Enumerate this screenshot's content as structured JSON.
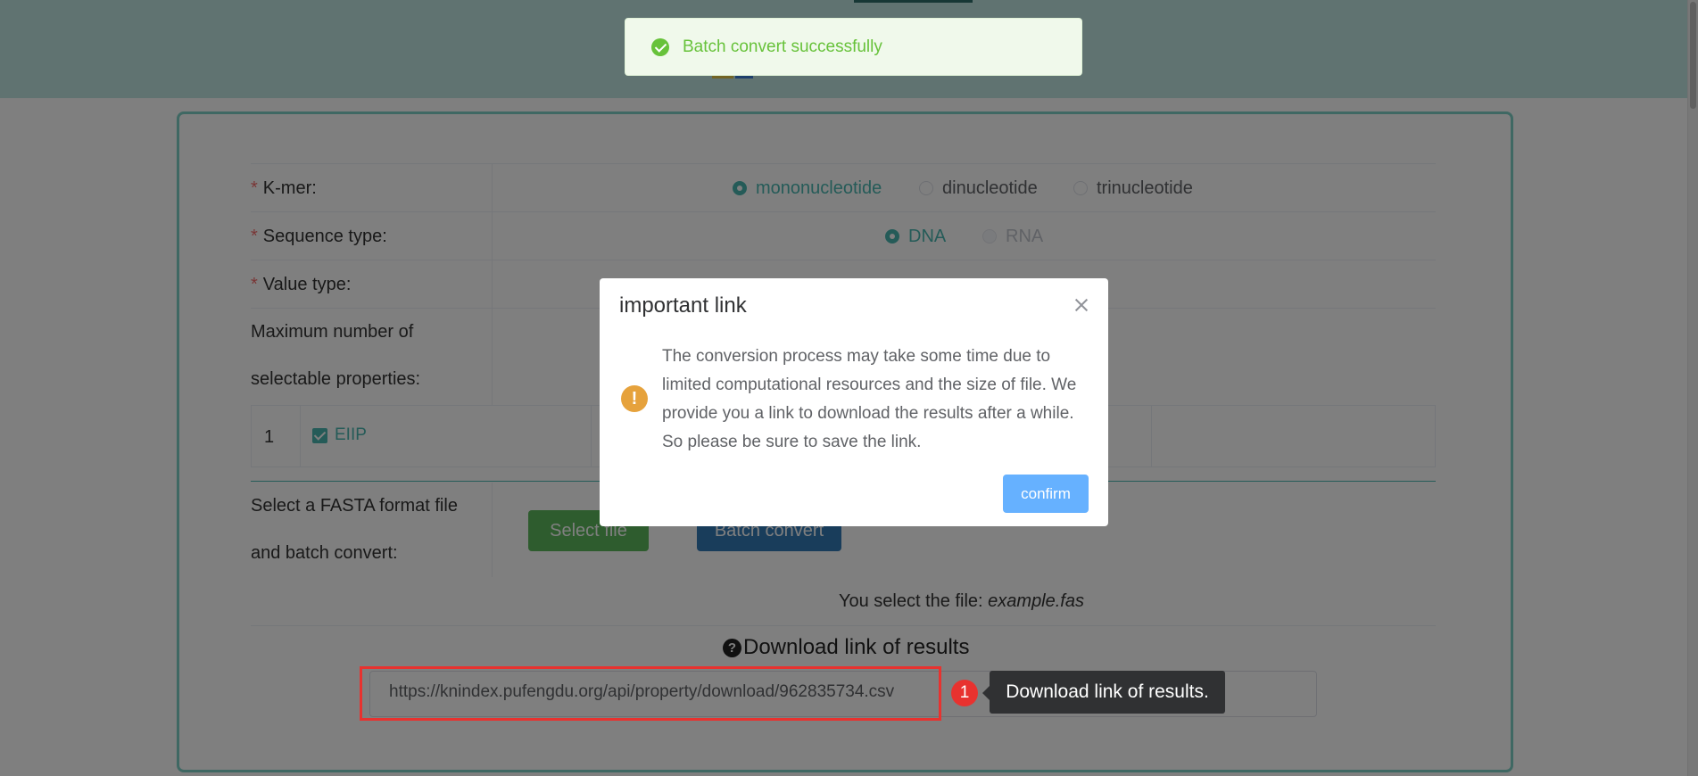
{
  "toast": {
    "icon": "check-circle-icon",
    "message": "Batch convert successfully"
  },
  "form": {
    "kmer": {
      "label": "K-mer:",
      "options": [
        "mononucleotide",
        "dinucleotide",
        "trinucleotide"
      ],
      "selected": "mononucleotide"
    },
    "sequence_type": {
      "label": "Sequence type:",
      "options": [
        "DNA",
        "RNA"
      ],
      "selected": "DNA",
      "disabled": [
        "RNA"
      ]
    },
    "value_type": {
      "label": "Value type:"
    },
    "max_properties": {
      "label_line1": "Maximum number of",
      "label_line2": "selectable properties:"
    },
    "properties_table": {
      "row_number": "1",
      "checked_property": "EIIP"
    },
    "file": {
      "label_line1": "Select a FASTA format file",
      "label_line2": "and batch convert:",
      "select_button": "Select file",
      "batch_button": "Batch convert",
      "selected_prefix": "You select the file:",
      "selected_name": "example.fas"
    },
    "download": {
      "title": "Download link of results",
      "title_icon": "question-circle-icon",
      "url": "https://knindex.pufengdu.org/api/property/download/962835734.csv"
    }
  },
  "dialog": {
    "title": "important link",
    "icon": "warning-icon",
    "message": "The conversion process may take some time due to limited computational resources and the size of file. We provide you a link to download the results after a while. So please be sure to save the link.",
    "confirm_label": "confirm"
  },
  "tour": {
    "step": "1",
    "tip": "Download link of results."
  },
  "colors": {
    "accent": "#4ab7b0",
    "header": "#c1e7e3",
    "success": "#67c23a",
    "warning": "#e6a23c",
    "highlight": "#e8322f"
  }
}
